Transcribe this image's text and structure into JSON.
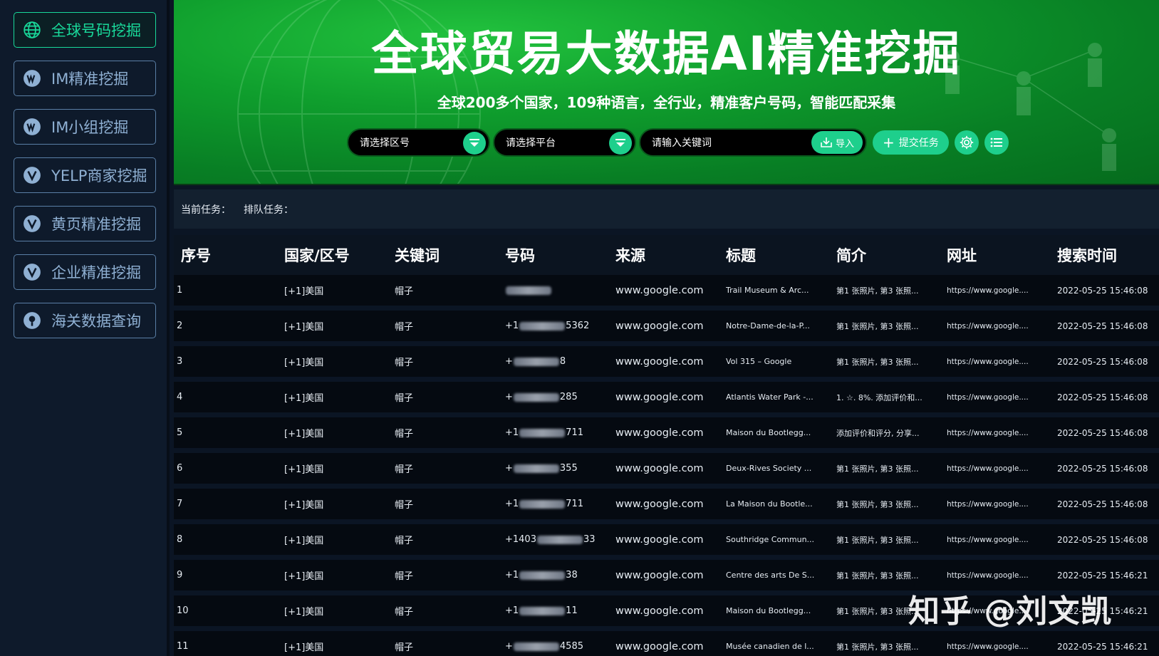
{
  "sidebar": {
    "items": [
      {
        "label": "全球号码挖掘",
        "icon": "globe-icon",
        "active": true
      },
      {
        "label": "IM精准挖掘",
        "icon": "whatsapp-icon"
      },
      {
        "label": "IM小组挖掘",
        "icon": "whatsapp-icon"
      },
      {
        "label": "YELP商家挖掘",
        "icon": "yelp-icon"
      },
      {
        "label": "黄页精准挖掘",
        "icon": "yellowpages-icon"
      },
      {
        "label": "企业精准挖掘",
        "icon": "enterprise-icon"
      },
      {
        "label": "海关数据查询",
        "icon": "customs-icon"
      }
    ]
  },
  "banner": {
    "title": "全球贸易大数据AI精准挖掘",
    "subtitle": "全球200多个国家，109种语言，全行业，精准客户号码，智能匹配采集"
  },
  "search": {
    "region_placeholder": "请选择区号",
    "platform_placeholder": "请选择平台",
    "keyword_placeholder": "请输入关键词",
    "import_label": "导入",
    "submit_label": "提交任务"
  },
  "taskbar": {
    "current_label": "当前任务：",
    "queue_label": "排队任务："
  },
  "table": {
    "headers": [
      "序号",
      "国家/区号",
      "关键词",
      "号码",
      "来源",
      "标题",
      "简介",
      "网址",
      "搜索时间"
    ],
    "rows": [
      {
        "no": "1",
        "country": "[+1]美国",
        "keyword": "帽子",
        "phone_prefix": "",
        "phone_suffix": "",
        "source": "www.google.com",
        "title": "Trail Museum & Arc...",
        "intro": "第1 张照片, 第3 张照...",
        "url": "https://www.google....",
        "time": "2022-05-25 15:46:08"
      },
      {
        "no": "2",
        "country": "[+1]美国",
        "keyword": "帽子",
        "phone_prefix": "+1",
        "phone_suffix": "5362",
        "source": "www.google.com",
        "title": "Notre-Dame-de-la-P...",
        "intro": "第1 张照片, 第3 张照...",
        "url": "https://www.google....",
        "time": "2022-05-25 15:46:08"
      },
      {
        "no": "3",
        "country": "[+1]美国",
        "keyword": "帽子",
        "phone_prefix": "+",
        "phone_suffix": "8",
        "source": "www.google.com",
        "title": "Vol 315 – Google",
        "intro": "第1 张照片, 第3 张照...",
        "url": "https://www.google....",
        "time": "2022-05-25 15:46:08"
      },
      {
        "no": "4",
        "country": "[+1]美国",
        "keyword": "帽子",
        "phone_prefix": "+",
        "phone_suffix": "285",
        "source": "www.google.com",
        "title": "Atlantis Water Park -...",
        "intro": "1. ☆. 8%. 添加评价和...",
        "url": "https://www.google....",
        "time": "2022-05-25 15:46:08"
      },
      {
        "no": "5",
        "country": "[+1]美国",
        "keyword": "帽子",
        "phone_prefix": "+1",
        "phone_suffix": "711",
        "source": "www.google.com",
        "title": "Maison du Bootlegg...",
        "intro": "添加评价和评分, 分享...",
        "url": "https://www.google....",
        "time": "2022-05-25 15:46:08"
      },
      {
        "no": "6",
        "country": "[+1]美国",
        "keyword": "帽子",
        "phone_prefix": "+",
        "phone_suffix": "355",
        "source": "www.google.com",
        "title": "Deux-Rives Society ...",
        "intro": "第1 张照片, 第3 张照...",
        "url": "https://www.google....",
        "time": "2022-05-25 15:46:08"
      },
      {
        "no": "7",
        "country": "[+1]美国",
        "keyword": "帽子",
        "phone_prefix": "+1",
        "phone_suffix": "711",
        "source": "www.google.com",
        "title": "La Maison du Bootle...",
        "intro": "第1 张照片, 第3 张照...",
        "url": "https://www.google....",
        "time": "2022-05-25 15:46:08"
      },
      {
        "no": "8",
        "country": "[+1]美国",
        "keyword": "帽子",
        "phone_prefix": "+1403",
        "phone_suffix": "33",
        "source": "www.google.com",
        "title": "Southridge Commun...",
        "intro": "第1 张照片, 第3 张照...",
        "url": "https://www.google....",
        "time": "2022-05-25 15:46:08"
      },
      {
        "no": "9",
        "country": "[+1]美国",
        "keyword": "帽子",
        "phone_prefix": "+1",
        "phone_suffix": "38",
        "source": "www.google.com",
        "title": "Centre des arts De S...",
        "intro": "第1 张照片, 第3 张照...",
        "url": "https://www.google....",
        "time": "2022-05-25 15:46:21"
      },
      {
        "no": "10",
        "country": "[+1]美国",
        "keyword": "帽子",
        "phone_prefix": "+1",
        "phone_suffix": "11",
        "source": "www.google.com",
        "title": "Maison du Bootlegg...",
        "intro": "第1 张照片, 第3 张照...",
        "url": "https://www.google....",
        "time": "2022-05-25 15:46:21"
      },
      {
        "no": "11",
        "country": "[+1]美国",
        "keyword": "帽子",
        "phone_prefix": "+",
        "phone_suffix": "4585",
        "source": "www.google.com",
        "title": "Musée canadien de l...",
        "intro": "第1 张照片, 第3 张照...",
        "url": "https://www.google....",
        "time": "2022-05-25 15:46:21"
      }
    ]
  },
  "watermark": "知乎 @刘文凯",
  "colors": {
    "accent": "#1ecf8c",
    "banner_green": "#0f9e2d",
    "background": "#0b1524"
  }
}
